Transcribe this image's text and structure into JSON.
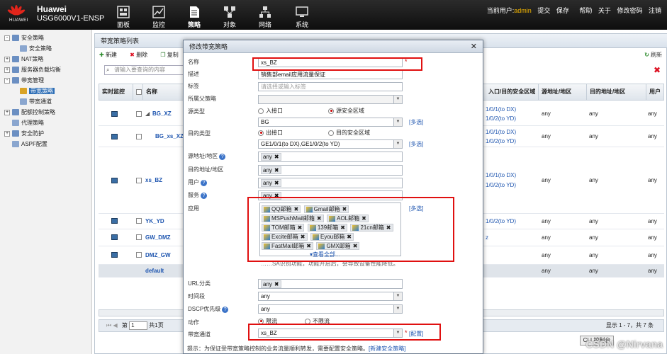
{
  "header": {
    "brand": "Huawei",
    "model": "USG6000V1-ENSP",
    "logo_text": "HUAWEI",
    "nav": [
      {
        "label": "面板",
        "icon": "dashboard-icon"
      },
      {
        "label": "监控",
        "icon": "monitor-icon"
      },
      {
        "label": "策略",
        "icon": "policy-icon"
      },
      {
        "label": "对象",
        "icon": "object-icon"
      },
      {
        "label": "网络",
        "icon": "network-icon"
      },
      {
        "label": "系统",
        "icon": "system-icon"
      }
    ],
    "current_user_label": "当前用户:",
    "current_user": "admin",
    "links": [
      "提交",
      "保存",
      "帮助",
      "关于",
      "修改密码",
      "注销"
    ]
  },
  "sidebar": {
    "items": [
      {
        "label": "安全策略",
        "expander": "-"
      },
      {
        "label": "安全策略",
        "expander": ""
      },
      {
        "label": "NAT策略",
        "expander": "+"
      },
      {
        "label": "服务器负载均衡",
        "expander": "+"
      },
      {
        "label": "带宽管理",
        "expander": "-"
      },
      {
        "label": "带宽策略",
        "expander": ""
      },
      {
        "label": "带宽通道",
        "expander": ""
      },
      {
        "label": "配额控制策略",
        "expander": "+"
      },
      {
        "label": "代理策略",
        "expander": ""
      },
      {
        "label": "安全防护",
        "expander": "+"
      },
      {
        "label": "ASPF配置",
        "expander": ""
      }
    ]
  },
  "main": {
    "title": "带宽策略列表",
    "toolbar": {
      "new": "新建",
      "delete": "删除",
      "copy": "复制",
      "move": "移"
    },
    "search_placeholder": "请输入要查询的内容",
    "refresh": "刷新",
    "columns": {
      "monitor": "实时监控",
      "name": "名称",
      "ingress": "入口/目的安全区域",
      "src_region": "源地址/地区",
      "dst_region": "目的地址/地区",
      "user": "用户"
    },
    "rows": [
      {
        "name": "BG_XZ",
        "zone1": "1/0/1(to DX)",
        "zone2": "1/0/2(to YD)",
        "src": "any",
        "dst": "any",
        "user": "any"
      },
      {
        "name": "BG_xs_XZ",
        "zone1": "1/0/1(to DX)",
        "zone2": "1/0/2(to YD)",
        "src": "any",
        "dst": "any",
        "user": "any"
      },
      {
        "name": "xs_BZ",
        "zone1": "1/0/1(to DX)",
        "zone2": "1/0/2(to YD)",
        "src": "any",
        "dst": "any",
        "user": "any"
      },
      {
        "name": "YK_YD",
        "zone1": "1/0/2(to YD)",
        "zone2": "",
        "src": "any",
        "dst": "any",
        "user": "any"
      },
      {
        "name": "GW_DMZ",
        "zone1": "z",
        "zone2": "",
        "src": "any",
        "dst": "any",
        "user": "any"
      },
      {
        "name": "DMZ_GW",
        "zone1": "",
        "zone2": "",
        "src": "any",
        "dst": "any",
        "user": "any"
      },
      {
        "name": "default",
        "zone1": "",
        "zone2": "",
        "src": "any",
        "dst": "any",
        "user": "any"
      }
    ],
    "pager": {
      "page": "1",
      "of_pages": "共1页",
      "summary": "显示 1 - 7，共 7 条"
    },
    "cli_button": "CLI 控制台"
  },
  "dialog": {
    "title": "修改带宽策略",
    "name_label": "名称",
    "name_value": "xs_BZ",
    "desc_label": "描述",
    "desc_value": "销售部email应用流量保证",
    "tag_label": "标签",
    "tag_placeholder": "请选择或输入标签",
    "parent_label": "所属父策略",
    "src_type_label": "源类型",
    "src_type_opt1": "入接口",
    "src_type_opt2": "源安全区域",
    "src_value": "BG",
    "dst_type_label": "目的类型",
    "dst_type_opt1": "出接口",
    "dst_type_opt2": "目的安全区域",
    "dst_value": "GE1/0/1(to DX),GE1/0/2(to YD)",
    "src_addr_label": "源地址/地区",
    "dst_addr_label": "目的地址/地区",
    "user_label": "用户",
    "service_label": "服务",
    "app_label": "应用",
    "any": "any",
    "multi_select": "[多选]",
    "apps": [
      "QQ邮箱",
      "Gmail邮箱",
      "MSPushMail邮箱",
      "AOL邮箱",
      "TOM邮箱",
      "139邮箱",
      "21cn邮箱",
      "Excite邮箱",
      "Eyou邮箱",
      "FastMail邮箱",
      "GMX邮箱"
    ],
    "view_all": "查看全部...",
    "hint": "……SA识别功能，功能开启后，会导致设备性能降低。",
    "url_label": "URL分类",
    "time_label": "时间段",
    "dscp_label": "DSCP优先级",
    "action_label": "动作",
    "action_opt1": "限流",
    "action_opt2": "不限流",
    "channel_label": "带宽通道",
    "channel_value": "xs_BZ",
    "configure": "[配置]",
    "footer_note": "提示：为保证受带宽策略控制的业务流量顺利转发，需要配置安全策略。",
    "footer_link": "[新建安全策略]"
  },
  "watermark": "CSDN @Nirvana",
  "colors": {
    "accent": "#2f6fb6",
    "highlight": "#e01010",
    "user": "#f5b700"
  }
}
